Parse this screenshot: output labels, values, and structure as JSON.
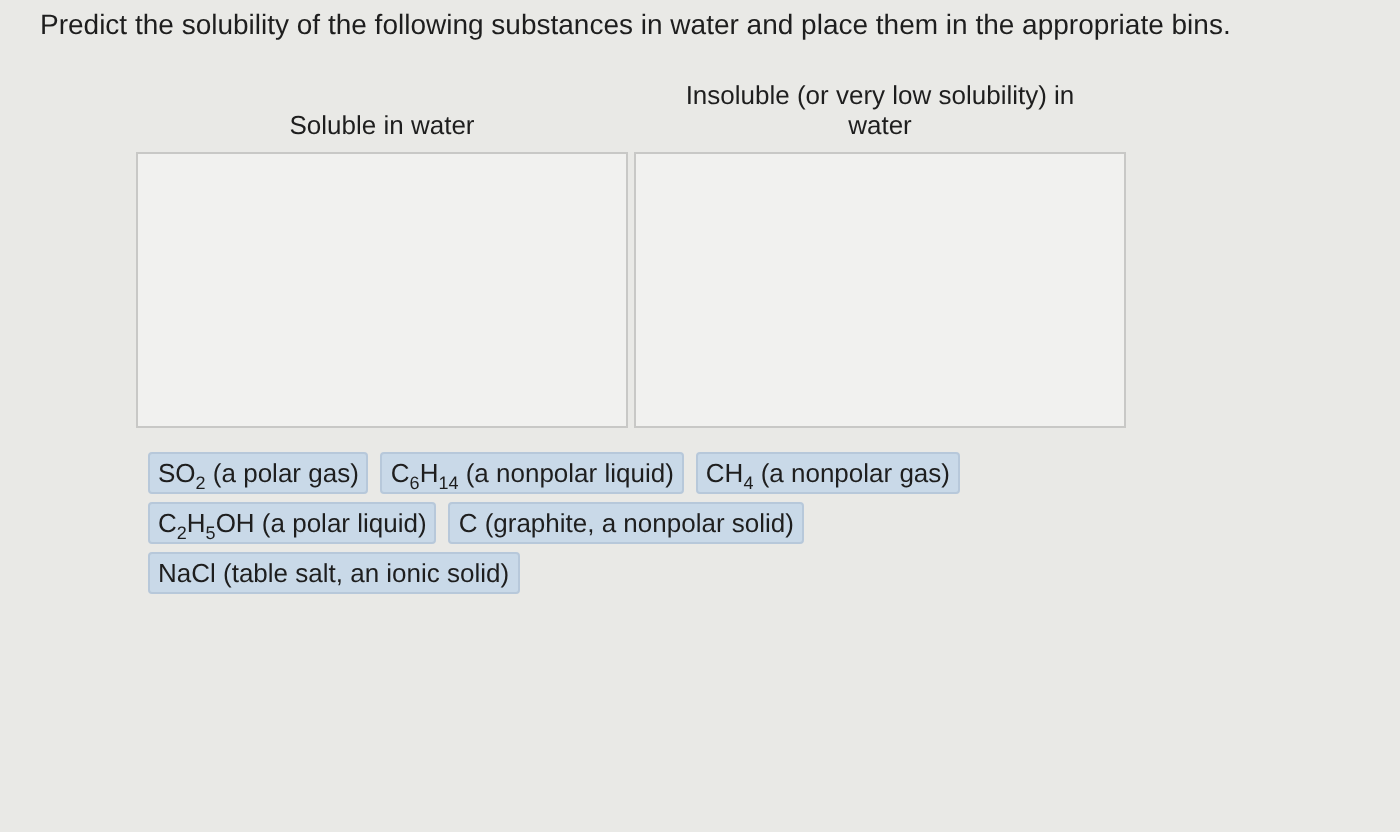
{
  "instruction": "Predict the solubility of the following substances in water and place them in the appropriate bins.",
  "bins": [
    {
      "label": "Soluble in water"
    },
    {
      "label": "Insoluble (or very low solubility) in water"
    }
  ],
  "items": [
    {
      "label": "SO$_{2}$ (a polar gas)"
    },
    {
      "label": "C$_{6}$H$_{14}$ (a nonpolar liquid)"
    },
    {
      "label": "CH$_{4}$ (a nonpolar gas)"
    },
    {
      "label": "C$_{2}$H$_{5}$OH (a polar liquid)"
    },
    {
      "label": "C (graphite, a nonpolar solid)"
    },
    {
      "label": "NaCl (table salt, an ionic solid)"
    }
  ]
}
